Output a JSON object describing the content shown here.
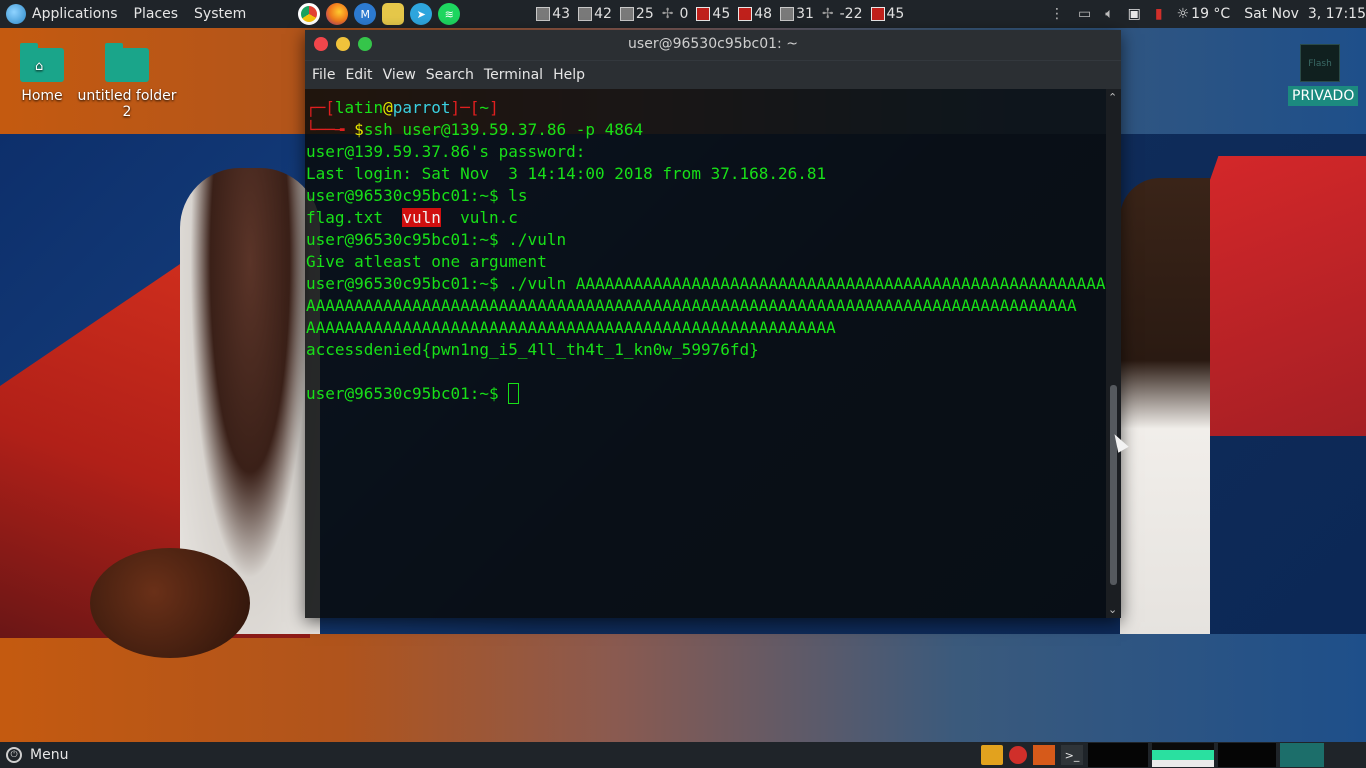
{
  "top_panel": {
    "menus": [
      "Applications",
      "Places",
      "System"
    ],
    "launchers": [
      {
        "icon": "chrome-icon",
        "color": "#e34234"
      },
      {
        "icon": "firefox-icon",
        "color": "#f07a1c"
      },
      {
        "icon": "maltego-icon",
        "color": "#2d7bd1"
      },
      {
        "icon": "keepass-icon",
        "color": "#e6c84a"
      },
      {
        "icon": "telegram-icon",
        "color": "#2ea6de"
      },
      {
        "icon": "spotify-icon",
        "color": "#1ed760"
      }
    ],
    "monitors": [
      {
        "value": "43"
      },
      {
        "value": "42"
      },
      {
        "value": "25"
      },
      {
        "value": "0"
      },
      {
        "value": "45"
      },
      {
        "value": "48"
      },
      {
        "value": "31"
      },
      {
        "value": "-22"
      },
      {
        "value": "45"
      }
    ],
    "weather": "19 °C",
    "clock": "Sat Nov  3, 17:15"
  },
  "desktop": {
    "icons": [
      {
        "label": "Home"
      },
      {
        "label": "untitled folder 2"
      }
    ],
    "flash_label": "Flash",
    "privado_label": "PRIVADO"
  },
  "terminal": {
    "title": "user@96530c95bc01: ~",
    "menu": [
      "File",
      "Edit",
      "View",
      "Search",
      "Terminal",
      "Help"
    ],
    "prompt_user": "latin",
    "prompt_host": "parrot",
    "prompt_dir": "~",
    "ssh_command": "ssh user@139.59.37.86 -p 4864",
    "lines": {
      "password": "user@139.59.37.86's password:",
      "last_login": "Last login: Sat Nov  3 14:14:00 2018 from 37.168.26.81",
      "ls_prompt": "user@96530c95bc01:~$ ls",
      "ls_flag": "flag.txt",
      "ls_vuln": "vuln",
      "ls_vulnc": "vuln.c",
      "run1": "user@96530c95bc01:~$ ./vuln",
      "arg_msg": "Give atleast one argument",
      "run2": "user@96530c95bc01:~$ ./vuln AAAAAAAAAAAAAAAAAAAAAAAAAAAAAAAAAAAAAAAAAAAAAAAAAAAAAAA",
      "run2_cont1": "AAAAAAAAAAAAAAAAAAAAAAAAAAAAAAAAAAAAAAAAAAAAAAAAAAAAAAAAAAAAAAAAAAAAAAAAAAAAAAAA",
      "run2_cont2": "AAAAAAAAAAAAAAAAAAAAAAAAAAAAAAAAAAAAAAAAAAAAAAAAAAAAAAA",
      "flag": "accessdenied{pwn1ng_i5_4ll_th4t_1_kn0w_59976fd}",
      "final_prompt": "user@96530c95bc01:~$ "
    }
  },
  "bottom_panel": {
    "menu_label": "Menu"
  }
}
